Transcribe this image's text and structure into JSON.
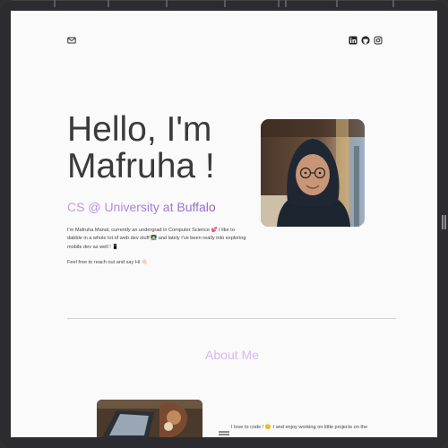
{
  "header": {
    "icons": [
      "mail-icon",
      "linkedin-icon",
      "github-icon",
      "instagram-icon"
    ]
  },
  "hero": {
    "title": "Hello, I'm Mafruha !",
    "subtitle": "CS @ University at Buffalo",
    "intro": "I'm Mafruha Manal, currently an undergrad in Computer Science 💕 I like to dabble in a whole lot of web dev stuff 👩‍💻 and lately I've been really into exploring mobile dev as well ! 📱",
    "cta": "Feel free to reach out and say Hi 👋🏻"
  },
  "about": {
    "heading": "About Me",
    "text": "I love to code ! 😊 I and enjoy working on little projects on the"
  },
  "colors": {
    "accent_start": "#c39be6",
    "accent_end": "#8e62c9",
    "about_heading": "#d9b8f2",
    "text": "#3a3a3a"
  }
}
